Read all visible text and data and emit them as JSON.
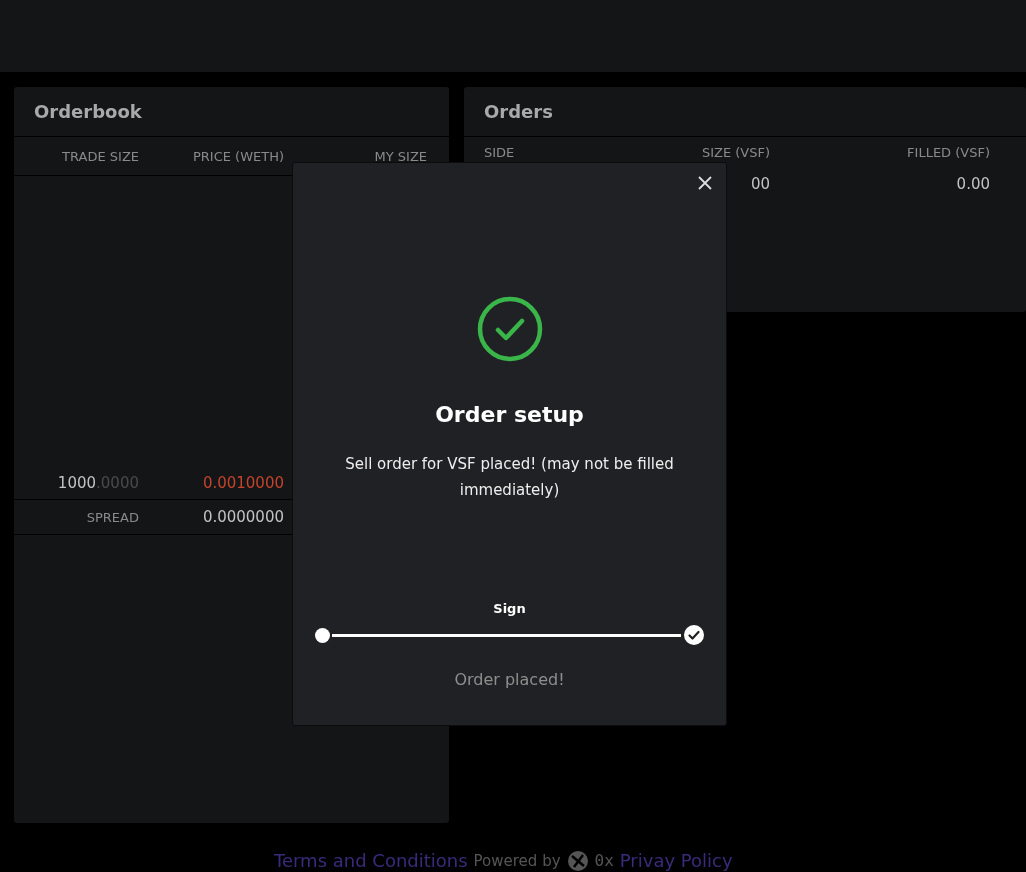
{
  "orderbook": {
    "title": "Orderbook",
    "columns": [
      "TRADE SIZE",
      "PRICE (WETH)",
      "MY SIZE"
    ],
    "rows": [
      {
        "color": "#c4432b",
        "size": "1000",
        "size_decimals": ".0000",
        "price": "0.0010000"
      }
    ],
    "spread": {
      "label": "SPREAD",
      "value": "0.0000000"
    }
  },
  "orders": {
    "title": "Orders",
    "columns": [
      "SIDE",
      "SIZE (VSF)",
      "FILLED (VSF)"
    ],
    "rows": [
      {
        "size": "00",
        "filled": "0.00"
      }
    ]
  },
  "modal": {
    "title": "Order setup",
    "message": "Sell order for VSF placed! (may not be filled immediately)",
    "steps": [
      {
        "label": "Sign",
        "done": true
      }
    ],
    "status": "Order placed!"
  },
  "footer": {
    "terms": "Terms and Conditions",
    "powered": "Powered by",
    "brand": "0x",
    "privacy": "Privay Policy"
  }
}
